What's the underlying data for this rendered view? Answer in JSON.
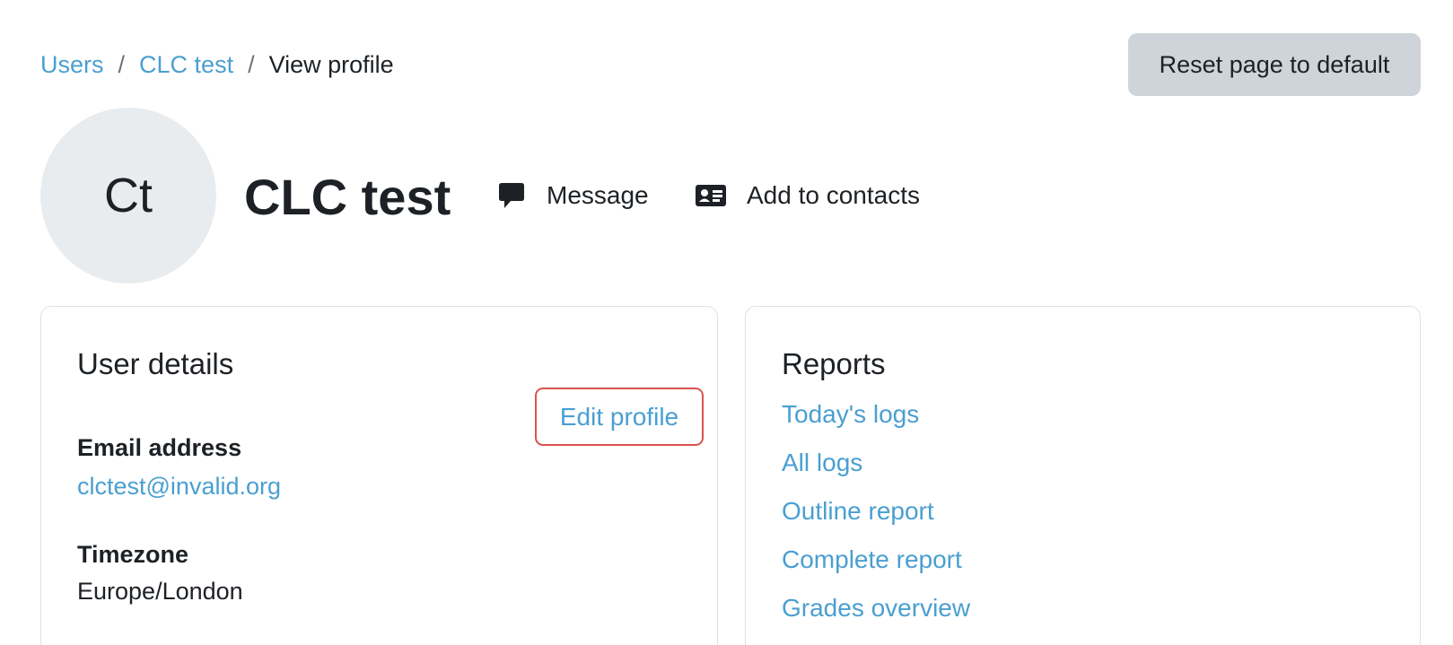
{
  "breadcrumb": {
    "items": [
      "Users",
      "CLC test"
    ],
    "separator": "/",
    "current": "View profile"
  },
  "reset_button": {
    "label": "Reset page to default"
  },
  "profile": {
    "avatar_initials": "Ct",
    "name": "CLC test",
    "message_label": "Message",
    "add_contacts_label": "Add to contacts"
  },
  "user_details": {
    "title": "User details",
    "edit_profile_label": "Edit profile",
    "email_label": "Email address",
    "email_value": "clctest@invalid.org",
    "timezone_label": "Timezone",
    "timezone_value": "Europe/London"
  },
  "reports": {
    "title": "Reports",
    "links": [
      "Today's logs",
      "All logs",
      "Outline report",
      "Complete report",
      "Grades overview"
    ]
  },
  "colors": {
    "link": "#4a9fd1",
    "button_bg": "#ced4da",
    "avatar_bg": "#e9ecef",
    "highlight_border": "#d9534f",
    "card_border": "#dee2e6"
  },
  "icons": {
    "message": "comment-icon",
    "add_contacts": "address-card-icon"
  }
}
